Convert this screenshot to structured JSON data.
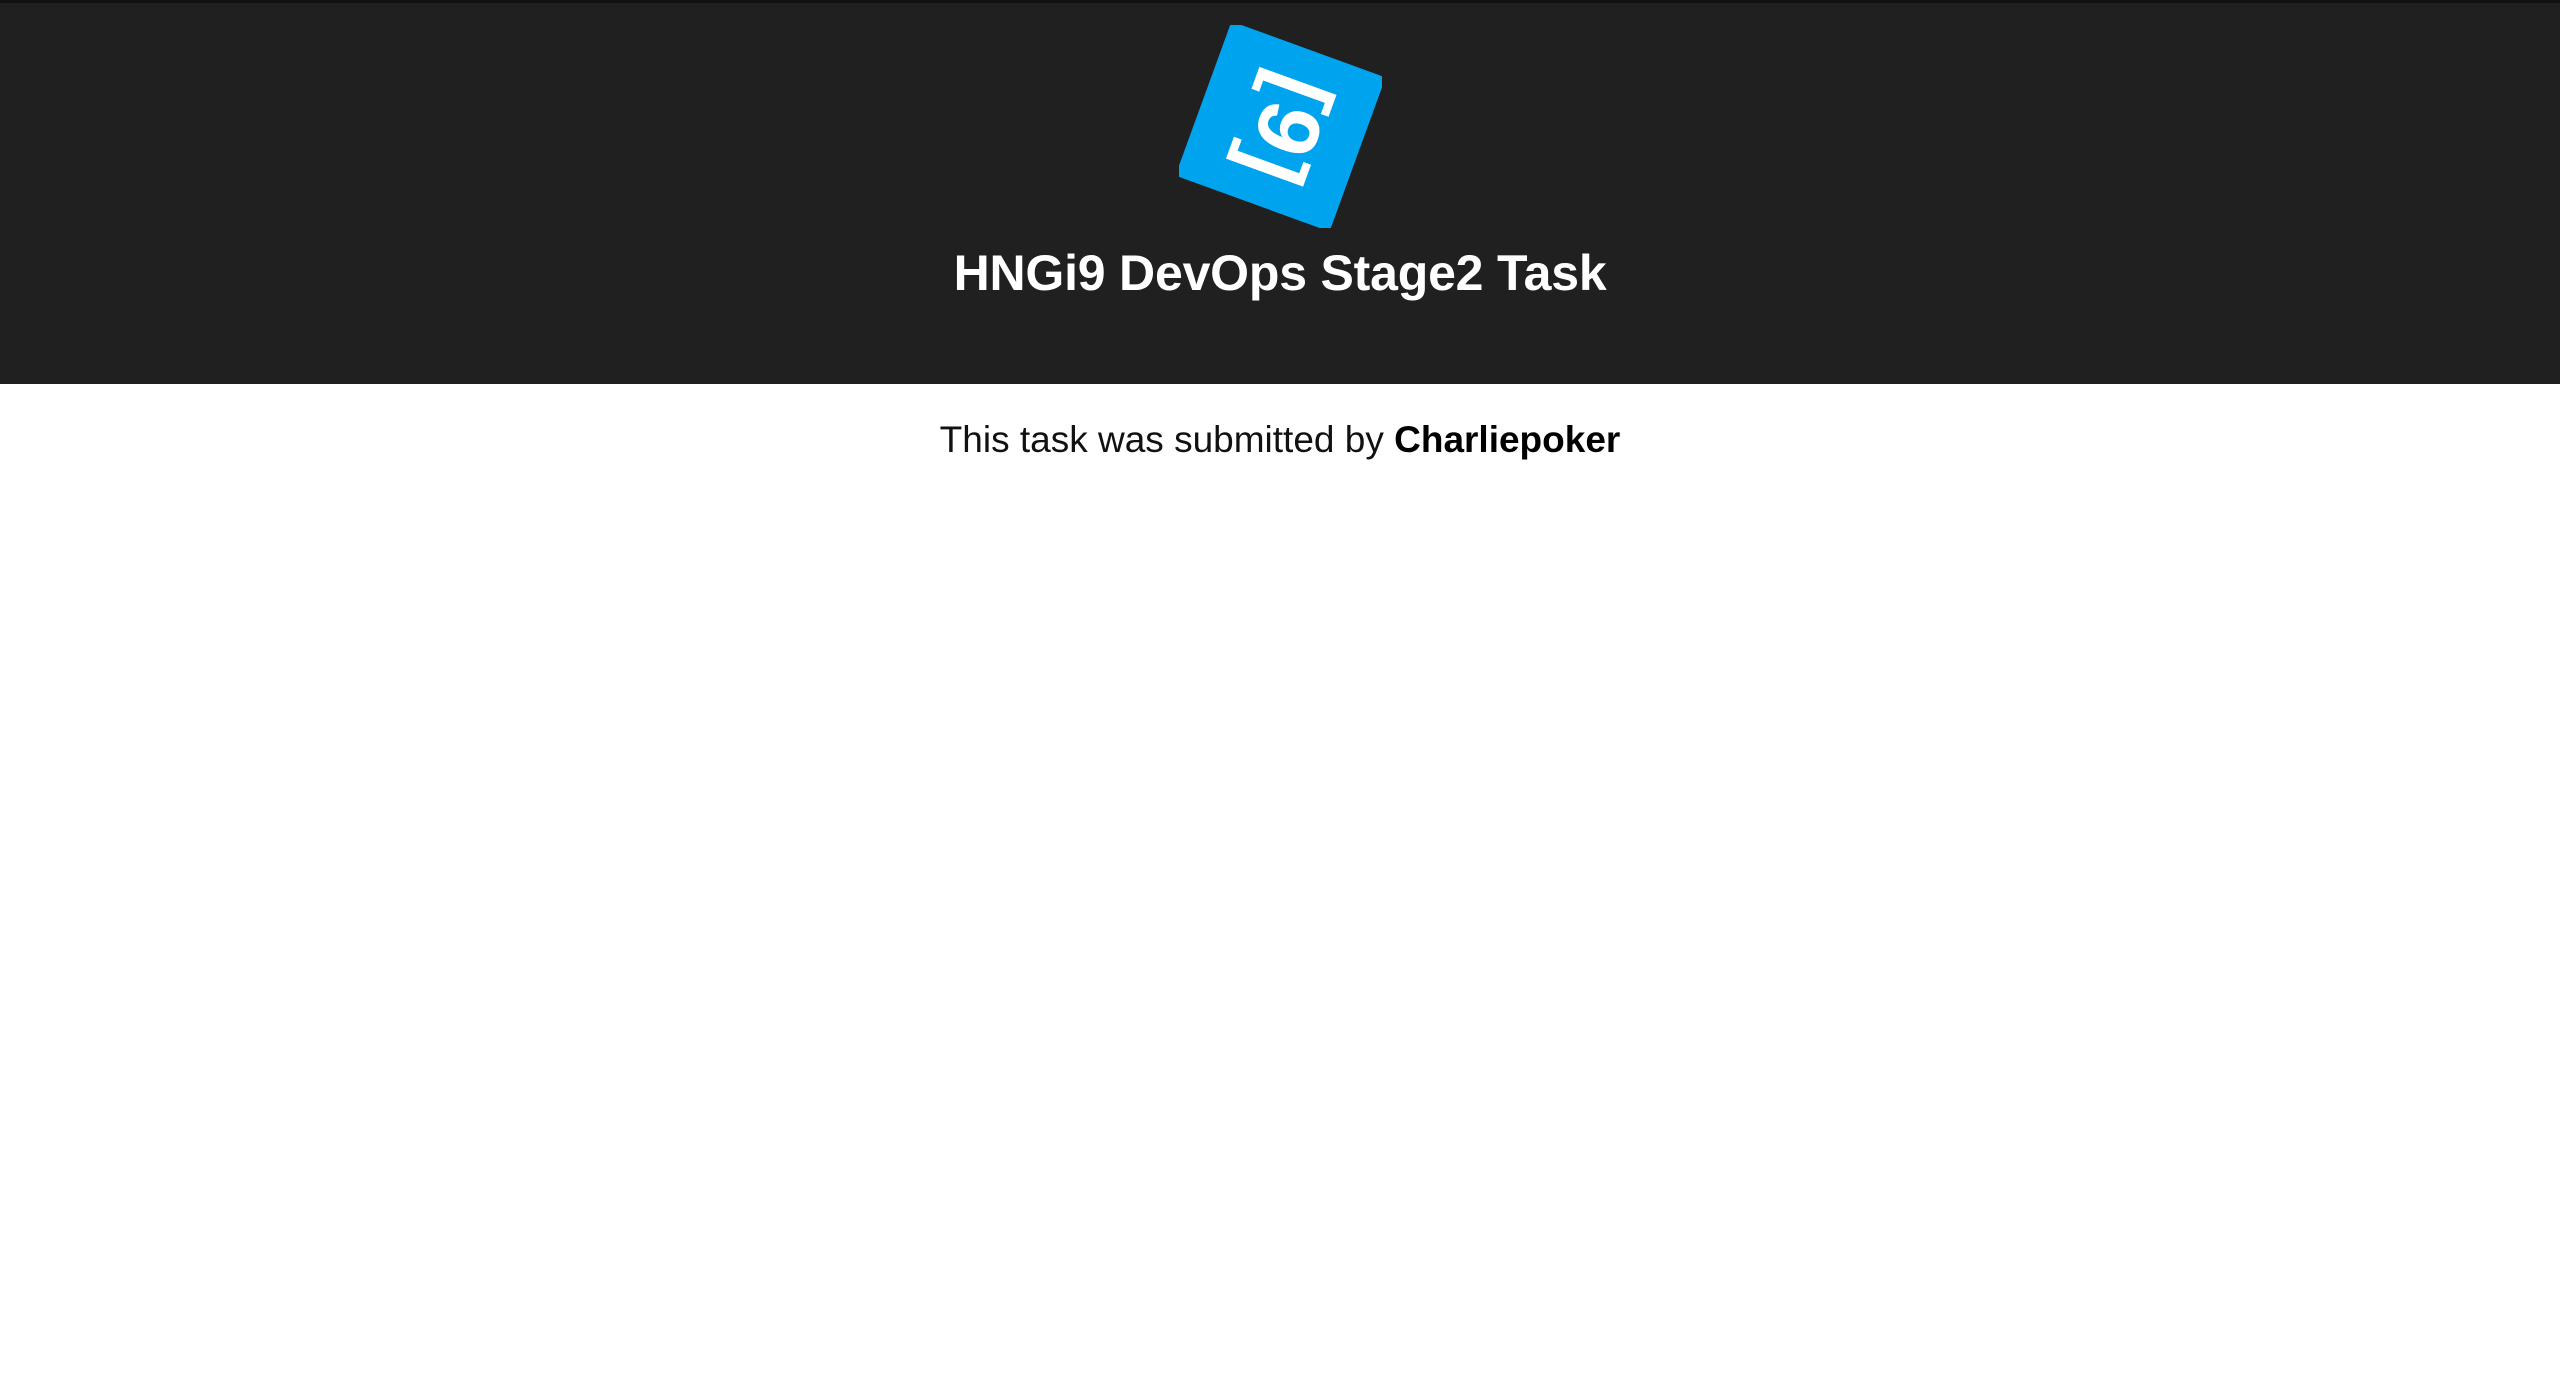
{
  "header": {
    "logo": {
      "icon": "hng-i9-logo-icon",
      "text": "[9]",
      "color": "#00A3EE",
      "glyph_color": "#FFFFFF"
    },
    "title": "HNGi9 DevOps Stage2 Task",
    "background": "#202020"
  },
  "main": {
    "submission_prefix": "This task was submitted by ",
    "author": "Charliepoker"
  }
}
